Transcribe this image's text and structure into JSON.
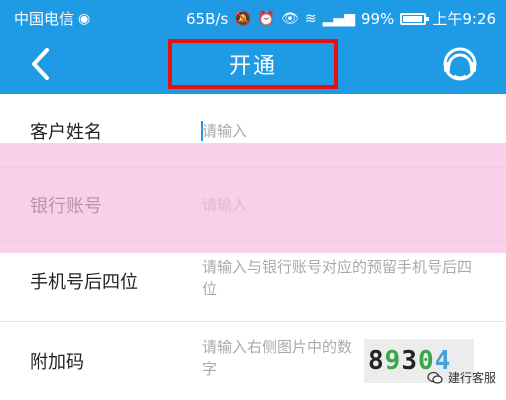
{
  "status_bar": {
    "carrier": "中国电信",
    "speed": "65B/s",
    "battery": "99%",
    "time": "上午9:26"
  },
  "nav": {
    "title": "开通",
    "back_icon": "chevron-left-icon",
    "service_icon": "customer-service-icon"
  },
  "form": {
    "name": {
      "label": "客户姓名",
      "placeholder": "请输入"
    },
    "account": {
      "label": "银行账号",
      "placeholder": "请输入"
    },
    "phone": {
      "label": "手机号后四位",
      "placeholder": "请输入与银行账号对应的预留手机号后四位"
    },
    "code": {
      "label": "附加码",
      "placeholder": "请输入右侧图片中的数字"
    }
  },
  "captcha": {
    "digits": [
      "8",
      "9",
      "3",
      "0",
      "4"
    ],
    "colors": [
      "#222222",
      "#3aa64a",
      "#222222",
      "#3aa64a",
      "#4aa0d8"
    ]
  },
  "overlay": {
    "color": "#f5bee1"
  },
  "watermark": {
    "text": "建行客服"
  },
  "colors": {
    "primary": "#1f9be6",
    "title_highlight": "#e81010"
  }
}
